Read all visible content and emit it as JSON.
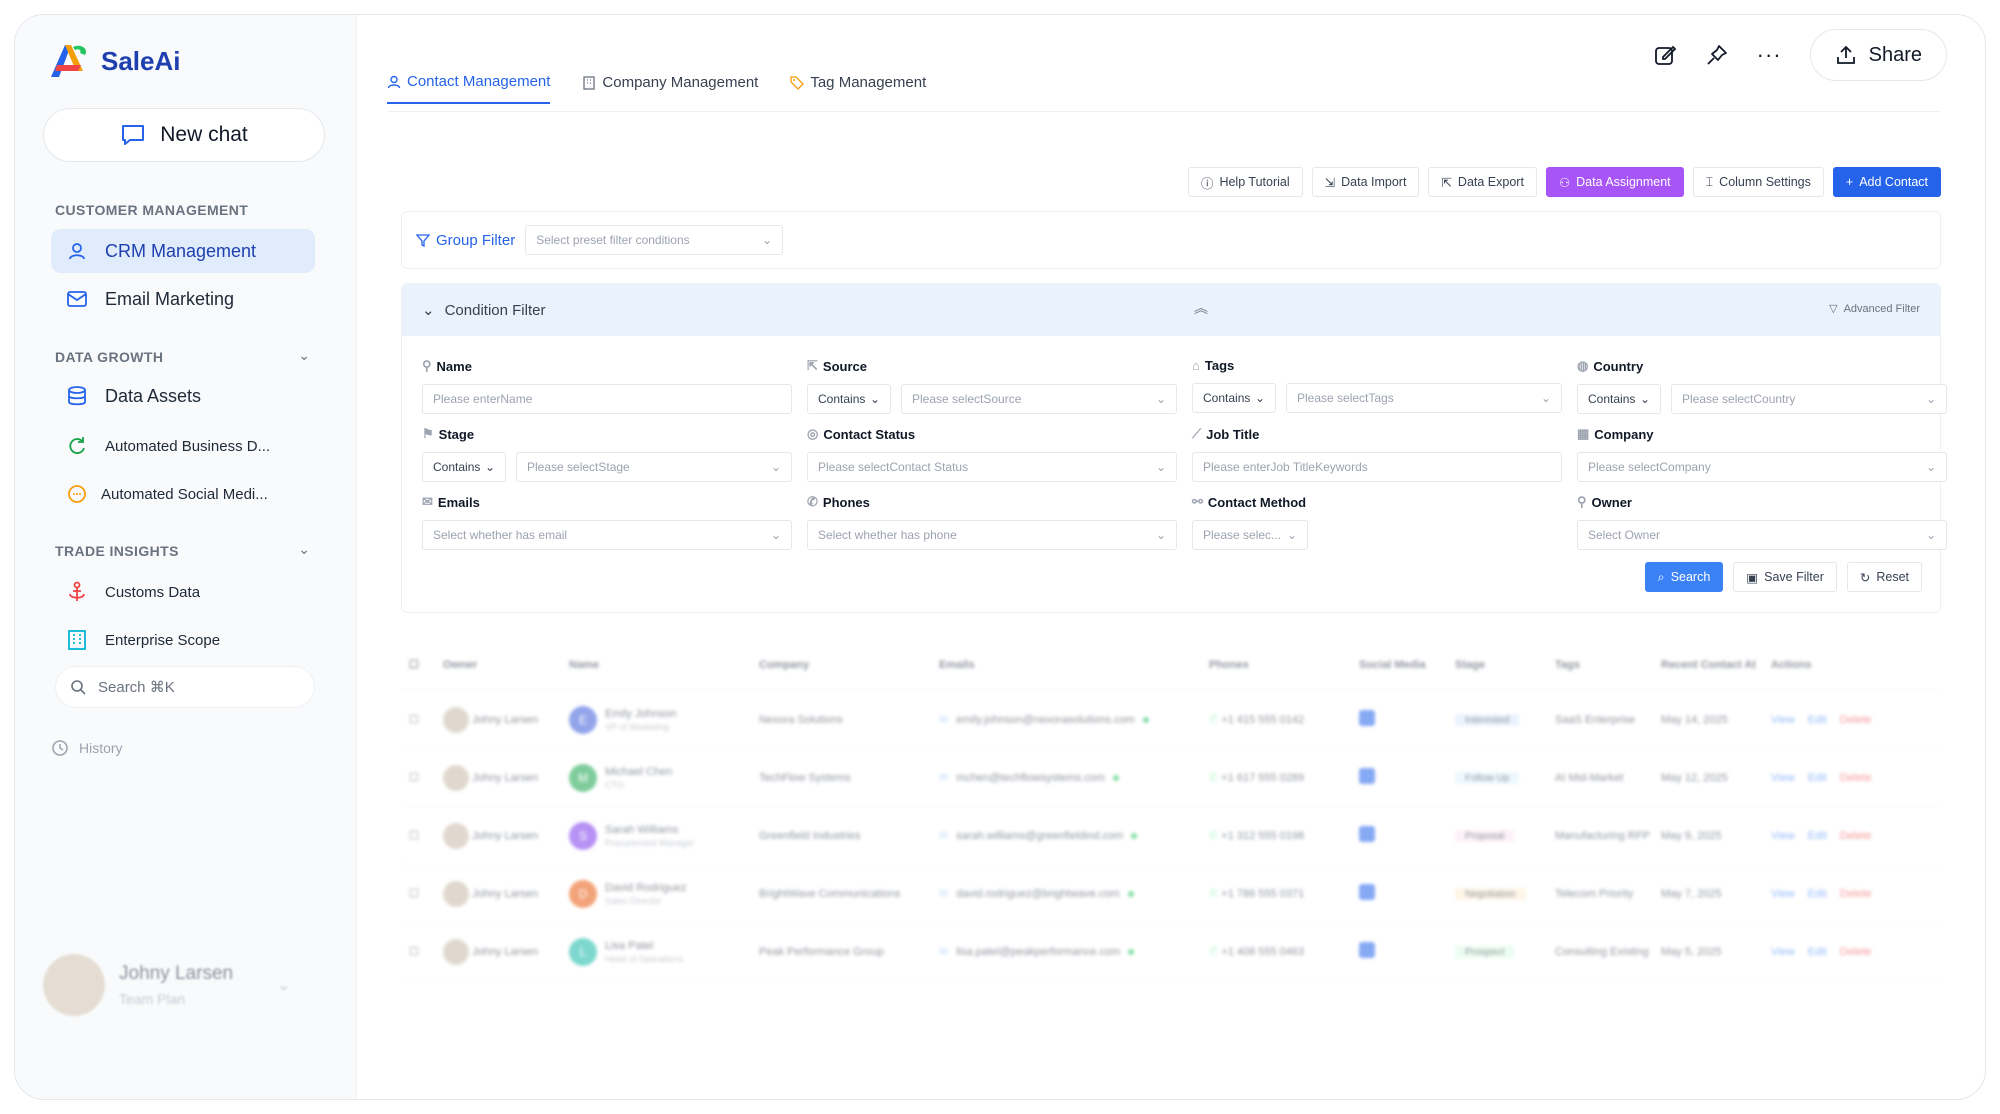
{
  "app": {
    "name": "SaleAi"
  },
  "sidebar": {
    "new_chat": "New chat",
    "customer_management": "CUSTOMER MANAGEMENT",
    "crm": "CRM Management",
    "email": "Email Marketing",
    "data_growth": "DATA GROWTH",
    "data_assets": "Data Assets",
    "auto_business": "Automated Business D...",
    "auto_social": "Automated Social Medi...",
    "trade_insights": "TRADE INSIGHTS",
    "customs": "Customs Data",
    "enterprise": "Enterprise Scope",
    "search": "Search ⌘K",
    "history": "History",
    "user_name": "Johny Larsen",
    "user_sub": "Team Plan"
  },
  "header": {
    "share": "Share"
  },
  "tabs": {
    "contact": "Contact Management",
    "company": "Company Management",
    "tag": "Tag Management"
  },
  "toolbar": {
    "help": "Help Tutorial",
    "import": "Data Import",
    "export": "Data Export",
    "assignment": "Data Assignment",
    "columns": "Column Settings",
    "add": "Add Contact"
  },
  "group_filter": {
    "label": "Group Filter",
    "placeholder": "Select preset filter conditions"
  },
  "condition_filter": {
    "title": "Condition Filter",
    "advanced": "Advanced Filter",
    "contains": "Contains",
    "name_label": "Name",
    "name_ph": "Please enterName",
    "source_label": "Source",
    "source_ph": "Please selectSource",
    "tags_label": "Tags",
    "tags_ph": "Please selectTags",
    "country_label": "Country",
    "country_ph": "Please selectCountry",
    "stage_label": "Stage",
    "stage_ph": "Please selectStage",
    "cstatus_label": "Contact Status",
    "cstatus_ph": "Please selectContact Status",
    "job_label": "Job Title",
    "job_ph": "Please enterJob TitleKeywords",
    "company_label": "Company",
    "company_ph": "Please selectCompany",
    "emails_label": "Emails",
    "emails_ph": "Select whether has email",
    "phones_label": "Phones",
    "phones_ph": "Select whether has phone",
    "method_label": "Contact Method",
    "method_ph": "Please selec...",
    "owner_label": "Owner",
    "owner_ph": "Select Owner",
    "search": "Search",
    "save": "Save Filter",
    "reset": "Reset"
  },
  "table": {
    "headers": {
      "owner": "Owner",
      "name": "Name",
      "company": "Company",
      "emails": "Emails",
      "phones": "Phones",
      "social": "Social Media",
      "stage": "Stage",
      "tags": "Tags",
      "recent": "Recent Contact At",
      "actions": "Actions"
    },
    "view": "View",
    "edit": "Edit",
    "delete": "Delete",
    "rows": [
      {
        "owner": "Johny Larsen",
        "initial": "E",
        "color": "#3b5bdb",
        "name": "Emily Johnson",
        "title": "VP of Marketing",
        "company": "Nexora Solutions",
        "email": "emily.johnson@nexorasolutions.com",
        "phone": "+1 415 555 0142",
        "stage": "Interested",
        "stage_color": "#dbeafe",
        "tag1": "SaaS",
        "tag2": "Enterprise",
        "date": "May 14, 2025"
      },
      {
        "owner": "Johny Larsen",
        "initial": "M",
        "color": "#16a34a",
        "name": "Michael Chen",
        "title": "CTO",
        "company": "TechFlow Systems",
        "email": "mchen@techflowsystems.com",
        "phone": "+1 617 555 0289",
        "stage": "Follow Up",
        "stage_color": "#e0f2fe",
        "tag1": "AI",
        "tag2": "Mid-Market",
        "date": "May 12, 2025"
      },
      {
        "owner": "Johny Larsen",
        "initial": "S",
        "color": "#7c3aed",
        "name": "Sarah Williams",
        "title": "Procurement Manager",
        "company": "Greenfield Industries",
        "email": "sarah.williams@greenfieldind.com",
        "phone": "+1 312 555 0198",
        "stage": "Proposal",
        "stage_color": "#fce7f3",
        "tag1": "Manufacturing",
        "tag2": "RFP",
        "date": "May 9, 2025"
      },
      {
        "owner": "Johny Larsen",
        "initial": "D",
        "color": "#ea580c",
        "name": "David Rodriguez",
        "title": "Sales Director",
        "company": "BrightWave Communications",
        "email": "david.rodriguez@brightwave.com",
        "phone": "+1 786 555 0371",
        "stage": "Negotiation",
        "stage_color": "#ffedd5",
        "tag1": "Telecom",
        "tag2": "Priority",
        "date": "May 7, 2025"
      },
      {
        "owner": "Johny Larsen",
        "initial": "L",
        "color": "#14b8a6",
        "name": "Lisa Patel",
        "title": "Head of Operations",
        "company": "Peak Performance Group",
        "email": "lisa.patel@peakperformance.com",
        "phone": "+1 408 555 0463",
        "stage": "Prospect",
        "stage_color": "#dcfce7",
        "tag1": "Consulting",
        "tag2": "Existing",
        "date": "May 5, 2025"
      }
    ]
  }
}
